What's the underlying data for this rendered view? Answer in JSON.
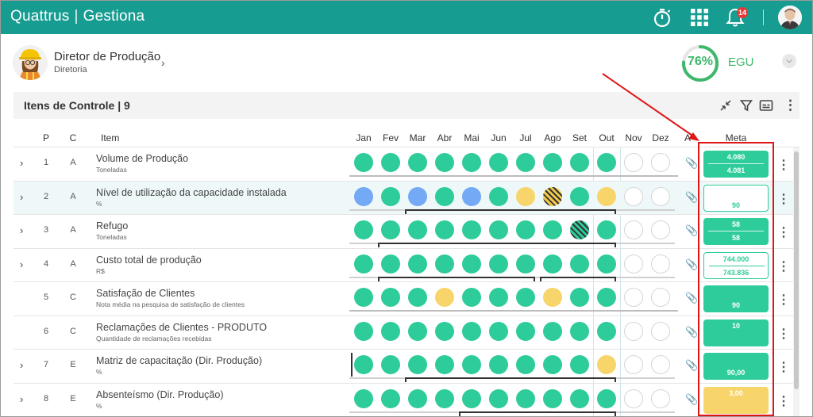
{
  "app": {
    "brand_left": "Quattrus",
    "brand_sep": "|",
    "brand_right": "Gestiona",
    "notification_count": "14"
  },
  "profile": {
    "name": "Diretor de Produção",
    "subtitle": "Diretoria",
    "score": "76%",
    "score_value": 76,
    "score_label": "EGU"
  },
  "section": {
    "title": "Itens de Controle | 9"
  },
  "columns": {
    "p": "P",
    "c": "C",
    "item": "Item",
    "a": "A",
    "meta": "Meta",
    "months": [
      "Jan",
      "Fev",
      "Mar",
      "Abr",
      "Mai",
      "Jun",
      "Jul",
      "Ago",
      "Set",
      "Out",
      "Nov",
      "Dez"
    ]
  },
  "rows": [
    {
      "p": "1",
      "c": "A",
      "title": "Volume de Produção",
      "unit": "Toneladas",
      "expandable": true,
      "dots": [
        "green",
        "green",
        "green",
        "green",
        "green",
        "green",
        "green",
        "green",
        "green",
        "green",
        "empty",
        "empty"
      ],
      "meta_top": "4.080",
      "meta_bottom": "4.081",
      "meta_style": "filled"
    },
    {
      "p": "2",
      "c": "A",
      "title": "Nível de utilização da capacidade instalada",
      "unit": "%",
      "expandable": true,
      "dots": [
        "blue",
        "green",
        "blue",
        "green",
        "blue",
        "green",
        "yellow",
        "hatch-yellow",
        "green",
        "yellow",
        "empty",
        "empty"
      ],
      "meta_top": "",
      "meta_bottom": "90",
      "meta_style": "outline"
    },
    {
      "p": "3",
      "c": "A",
      "title": "Refugo",
      "unit": "Toneladas",
      "expandable": true,
      "dots": [
        "green",
        "green",
        "green",
        "green",
        "green",
        "green",
        "green",
        "green",
        "hatch-green",
        "green",
        "empty",
        "empty"
      ],
      "meta_top": "58",
      "meta_bottom": "58",
      "meta_style": "filled"
    },
    {
      "p": "4",
      "c": "A",
      "title": "Custo total de produção",
      "unit": "R$",
      "expandable": true,
      "dots": [
        "green",
        "green",
        "green",
        "green",
        "green",
        "green",
        "green",
        "green",
        "green",
        "green",
        "empty",
        "empty"
      ],
      "meta_top": "744.000",
      "meta_bottom": "743.836",
      "meta_style": "outline"
    },
    {
      "p": "5",
      "c": "C",
      "title": "Satisfação de Clientes",
      "unit": "Nota média na pesquisa de satisfação de clientes",
      "expandable": false,
      "dots": [
        "green",
        "green",
        "green",
        "yellow",
        "green",
        "green",
        "green",
        "yellow",
        "green",
        "green",
        "empty",
        "empty"
      ],
      "meta_top": "",
      "meta_bottom": "90",
      "meta_style": "filled"
    },
    {
      "p": "6",
      "c": "C",
      "title": "Reclamações de Clientes - PRODUTO",
      "unit": "Quantidade de reclamações recebidas",
      "expandable": false,
      "dots": [
        "green",
        "green",
        "green",
        "green",
        "green",
        "green",
        "green",
        "green",
        "green",
        "green",
        "empty",
        "empty"
      ],
      "meta_top": "10",
      "meta_bottom": "",
      "meta_style": "filled"
    },
    {
      "p": "7",
      "c": "E",
      "title": "Matriz de capacitação (Dir. Produção)",
      "unit": "%",
      "expandable": true,
      "dots": [
        "green",
        "green",
        "green",
        "green",
        "green",
        "green",
        "green",
        "green",
        "green",
        "yellow",
        "empty",
        "empty"
      ],
      "meta_top": "",
      "meta_bottom": "90,00",
      "meta_style": "filled"
    },
    {
      "p": "8",
      "c": "E",
      "title": "Absenteísmo (Dir. Produção)",
      "unit": "%",
      "expandable": true,
      "dots": [
        "green",
        "green",
        "green",
        "green",
        "green",
        "green",
        "green",
        "green",
        "green",
        "green",
        "empty",
        "empty"
      ],
      "meta_top": "3,00",
      "meta_bottom": "",
      "meta_style": "yellow"
    }
  ],
  "colors": {
    "brand": "#169c91",
    "green": "#2ecc9a",
    "blue": "#74a9f5",
    "yellow": "#f7d56b",
    "annotation": "#e01515"
  }
}
